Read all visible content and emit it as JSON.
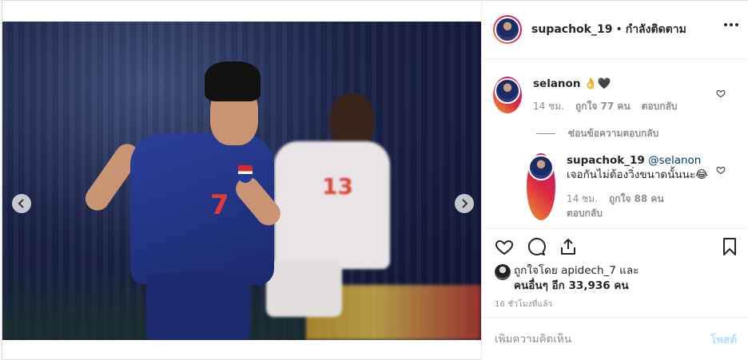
{
  "post": {
    "header": {
      "username": "supachok_19",
      "separator": "•",
      "follow_status": "กำลังติดตาม"
    },
    "photo": {
      "blue_jersey_number": "7",
      "white_jersey_number": "13"
    },
    "comments": [
      {
        "username": "selanon",
        "text": "👌🖤",
        "time": "14 ชม.",
        "likes": "ถูกใจ 77 คน",
        "reply_label": "ตอบกลับ",
        "toggle_replies": "ซ่อนข้อความตอบกลับ"
      },
      {
        "username": "supachok_19",
        "mention": "@selanon",
        "text": "เจอกันไม่ต้องวิ่งขนาดนั้นนะ😂",
        "time": "14 ชม.",
        "likes": "ถูกใจ 88 คน",
        "reply_label": "ตอบกลับ"
      }
    ],
    "liked_by": {
      "line1": "ถูกใจโดย apidech_7 และ",
      "line2": "คนอื่นๆ อีก 33,936 คน"
    },
    "time_ago": "16 ชั่วโมงที่แล้ว",
    "add_comment": {
      "placeholder": "เพิ่มความคิดเห็น",
      "post_label": "โพสต์"
    }
  },
  "icons": {
    "more": "more-horizontal-icon",
    "like": "heart-icon",
    "comment": "comment-bubble-icon",
    "share": "share-icon",
    "save": "bookmark-icon",
    "prev": "chevron-left-icon",
    "next": "chevron-right-icon"
  }
}
